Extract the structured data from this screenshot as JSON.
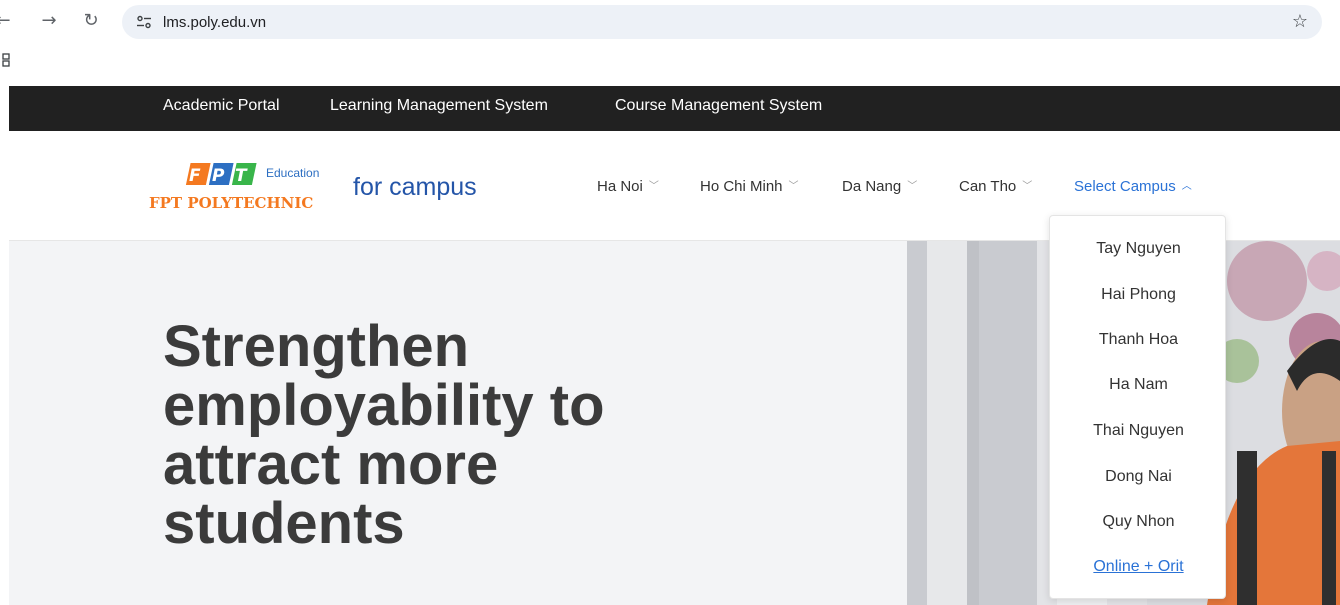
{
  "browser": {
    "url": "lms.poly.edu.vn",
    "back_icon": "arrow-left-icon",
    "forward_icon": "arrow-right-icon",
    "reload_icon": "reload-icon",
    "site_info_icon": "tune-icon",
    "bookmark_icon": "star-icon"
  },
  "topnav": {
    "links": [
      "Academic Portal",
      "Learning Management System",
      "Course Management System"
    ]
  },
  "header": {
    "logo_top": "FPT",
    "logo_edu": "Education",
    "logo_bottom": "FPT POLYTECHNIC",
    "tagline": "for campus",
    "campuses": [
      "Ha Noi",
      "Ho Chi Minh",
      "Da Nang",
      "Can Tho"
    ],
    "select_campus": "Select Campus"
  },
  "hero": {
    "lines": [
      "Strengthen",
      "employability to",
      "attract more",
      "students"
    ]
  },
  "dropdown": {
    "items": [
      "Tay Nguyen",
      "Hai Phong",
      "Thanh Hoa",
      "Ha Nam",
      "Thai Nguyen",
      "Dong Nai",
      "Quy Nhon"
    ],
    "link_item": "Online + Orit"
  },
  "colors": {
    "topbar": "#212121",
    "accent": "#2a72d6",
    "logo_orange": "#f47920",
    "hero_bg": "#f3f4f6"
  }
}
